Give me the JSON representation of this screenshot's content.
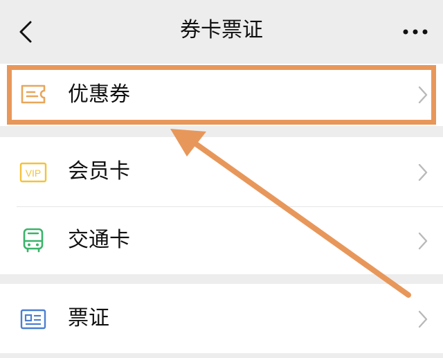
{
  "header": {
    "title": "券卡票证",
    "back_icon": "chevron-left-icon",
    "more_icon": "more-dots-icon"
  },
  "items": [
    {
      "label": "优惠券",
      "icon": "coupon-icon",
      "color": "#e8a65a"
    },
    {
      "label": "会员卡",
      "icon": "vip-card-icon",
      "icon_text": "VIP",
      "color": "#f2c33a"
    },
    {
      "label": "交通卡",
      "icon": "bus-icon",
      "color": "#3ab36a"
    },
    {
      "label": "票证",
      "icon": "id-ticket-icon",
      "color": "#4a7fd1"
    }
  ],
  "annotation": {
    "color": "#e8975a"
  }
}
